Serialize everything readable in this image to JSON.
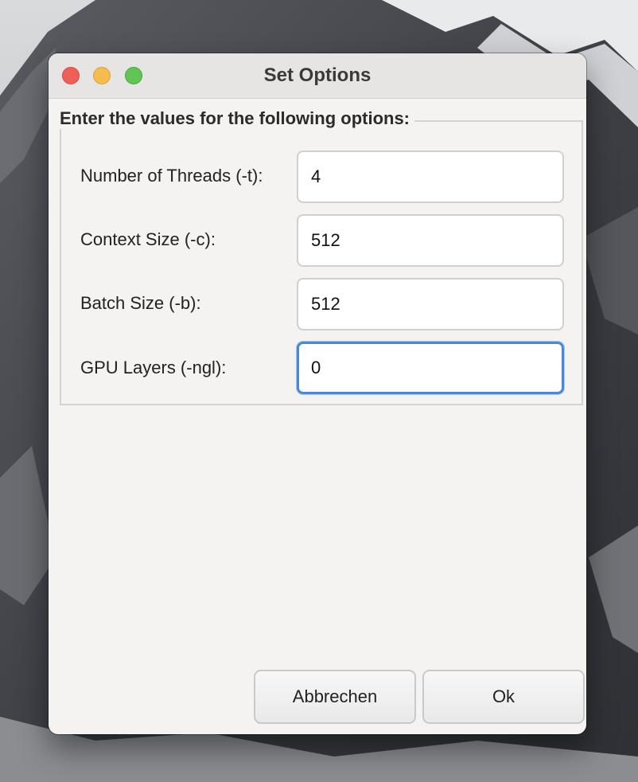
{
  "window": {
    "title": "Set Options"
  },
  "traffic_lights": {
    "close_color": "#ee5f57",
    "minimize_color": "#f5bd4f",
    "maximize_color": "#61c454"
  },
  "group": {
    "legend": "Enter the values for the following options:"
  },
  "options": [
    {
      "label": "Number of Threads (-t):",
      "value": "4"
    },
    {
      "label": "Context Size (-c):",
      "value": "512"
    },
    {
      "label": "Batch Size (-b):",
      "value": "512"
    },
    {
      "label": "GPU Layers (-ngl):",
      "value": "0"
    }
  ],
  "buttons": {
    "cancel_label": "Abbrechen",
    "ok_label": "Ok"
  },
  "colors": {
    "focus_ring": "#4d87d6",
    "window_background": "#f4f3f1"
  }
}
